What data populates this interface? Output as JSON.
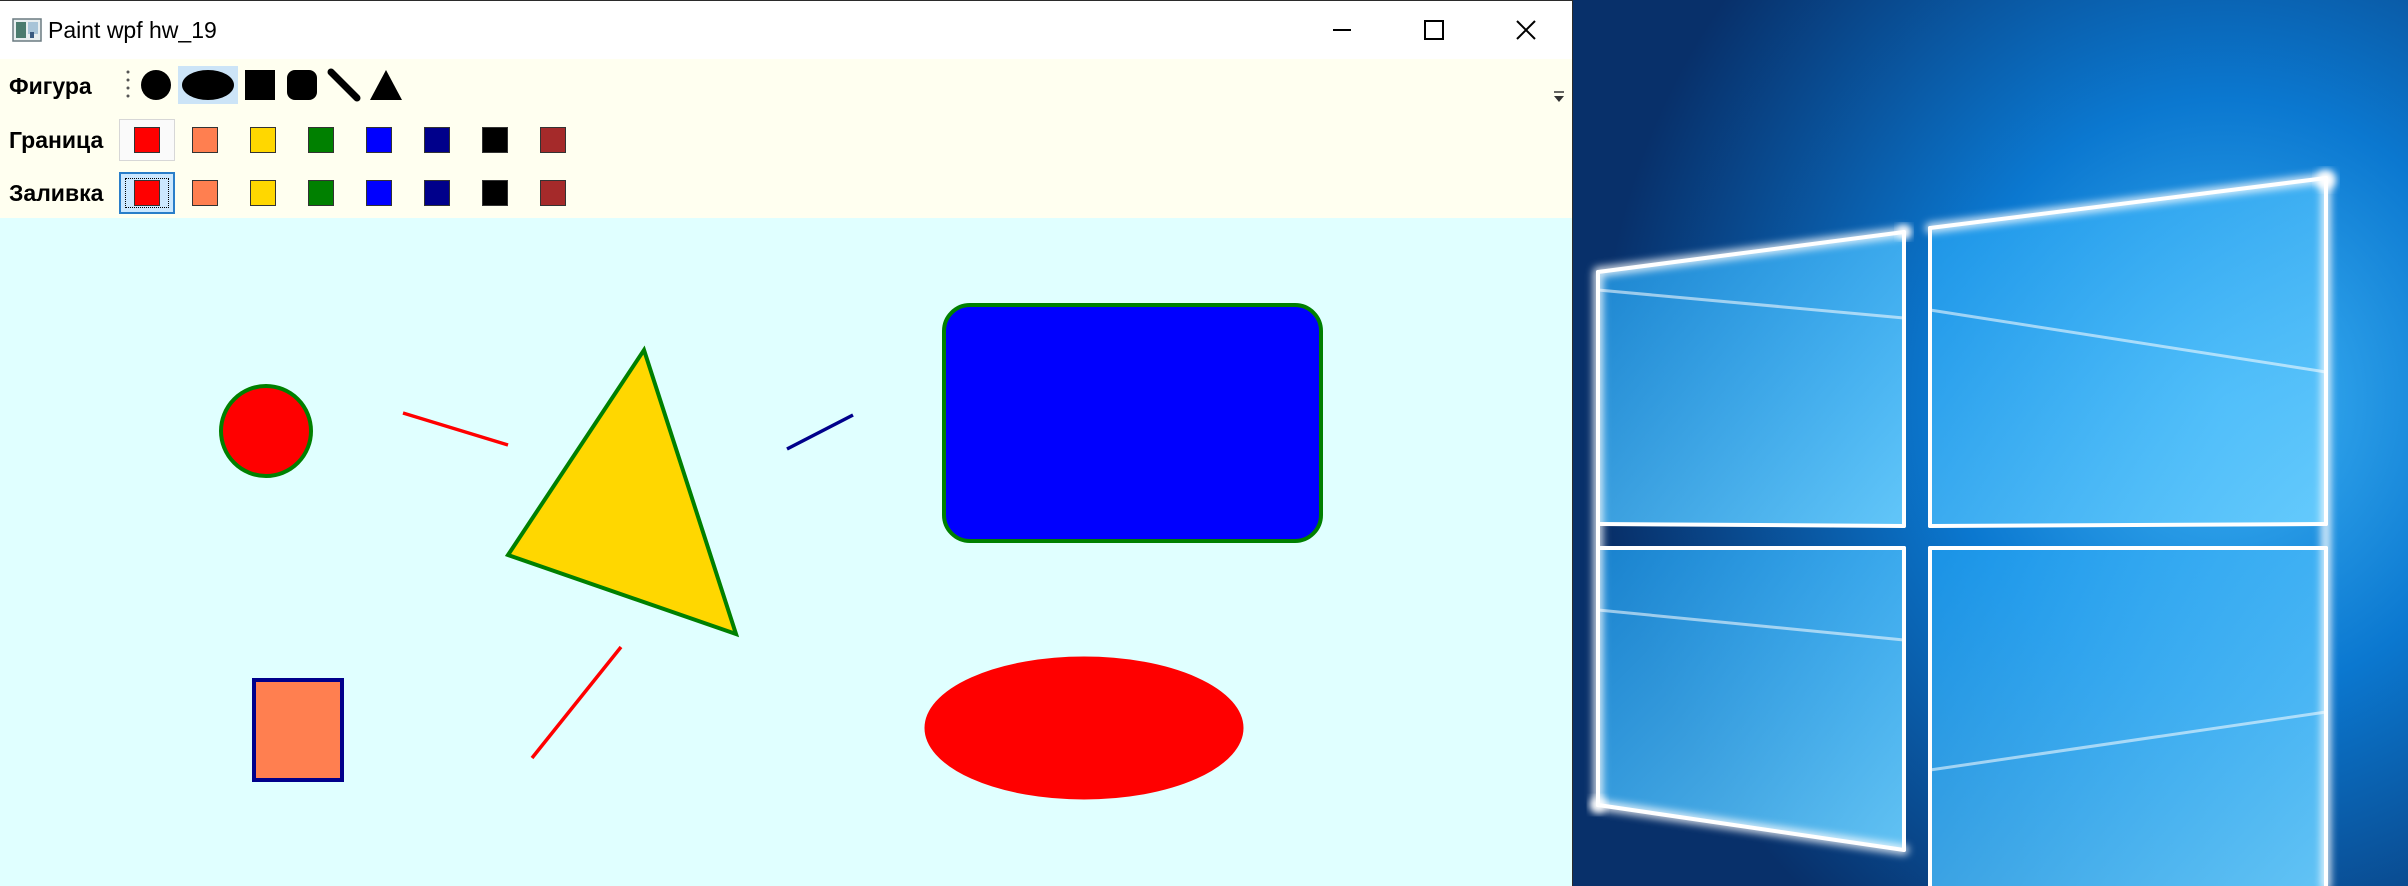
{
  "window": {
    "title": "Paint wpf hw_19",
    "controls": [
      "minimize-icon",
      "maximize-icon",
      "close-icon"
    ]
  },
  "toolbar": {
    "rows": {
      "shape": {
        "label": "Фигура"
      },
      "border": {
        "label": "Граница"
      },
      "fill": {
        "label": "Заливка"
      }
    },
    "shape_tools": [
      {
        "name": "circle",
        "icon": "circle-icon"
      },
      {
        "name": "ellipse",
        "icon": "ellipse-icon",
        "selected": true
      },
      {
        "name": "square",
        "icon": "square-icon"
      },
      {
        "name": "rounded-rectangle",
        "icon": "rounded-rect-icon"
      },
      {
        "name": "line",
        "icon": "line-icon"
      },
      {
        "name": "triangle",
        "icon": "triangle-icon"
      }
    ],
    "palette": [
      {
        "name": "red",
        "color": "#ff0000"
      },
      {
        "name": "coral",
        "color": "#ff7f50"
      },
      {
        "name": "gold",
        "color": "#ffd700"
      },
      {
        "name": "green",
        "color": "#008000"
      },
      {
        "name": "blue",
        "color": "#0000ff"
      },
      {
        "name": "navy",
        "color": "#00008b"
      },
      {
        "name": "black",
        "color": "#000000"
      },
      {
        "name": "brown",
        "color": "#a52a2a"
      }
    ],
    "selected_border": "red",
    "selected_fill": "red"
  },
  "canvas": {
    "background": "#e0ffff",
    "shapes": [
      {
        "type": "circle",
        "fill": "#ff0000",
        "stroke": "#008000"
      },
      {
        "type": "line",
        "stroke": "#ff0000"
      },
      {
        "type": "triangle",
        "fill": "#ffd700",
        "stroke": "#008000"
      },
      {
        "type": "line",
        "stroke": "#00008b"
      },
      {
        "type": "rounded-rectangle",
        "fill": "#0000ff",
        "stroke": "#008000"
      },
      {
        "type": "square",
        "fill": "#ff7f50",
        "stroke": "#00008b"
      },
      {
        "type": "line",
        "stroke": "#ff0000"
      },
      {
        "type": "ellipse",
        "fill": "#ff0000",
        "stroke": "#ff0000"
      }
    ]
  },
  "desktop": {
    "wallpaper": "windows-10-logo-light",
    "colors": {
      "dark": "#0a2a5c",
      "mid": "#0b63b6",
      "light": "#41b4f5"
    }
  }
}
